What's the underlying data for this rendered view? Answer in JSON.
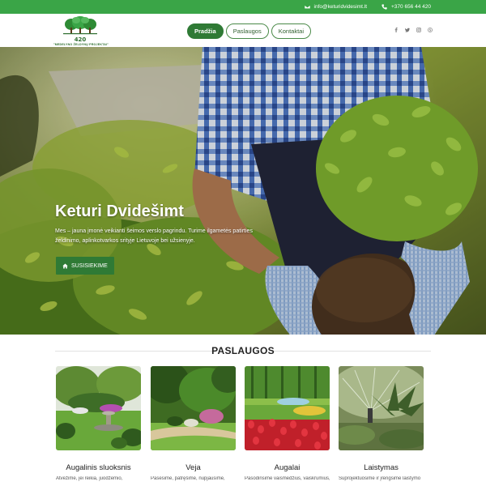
{
  "topbar": {
    "email": "info@keturidvidesimt.lt",
    "phone": "+370 656 44 420",
    "icons": [
      "envelope-icon",
      "phone-icon"
    ],
    "bg_color": "#3aa547"
  },
  "header": {
    "logo_number": "420",
    "logo_caption": "\"MEDELYNO ŽELDYNŲ PROJEKTAI\"",
    "nav": [
      {
        "label": "Pradžia",
        "active": true
      },
      {
        "label": "Paslaugos",
        "active": false
      },
      {
        "label": "Kontaktai",
        "active": false
      }
    ],
    "social_icons": [
      "facebook-icon",
      "twitter-icon",
      "instagram-icon",
      "skype-icon"
    ]
  },
  "hero": {
    "title": "Keturi Dvidešimt",
    "text": "Mes – jauna įmonė veikianti šeimos verslo pagrindu. Turime ilgametės patirties želdinimo, aplinkotvarkos srityje Lietuvoje bei užsienyje.",
    "button_label": "SUSISIEKIME",
    "button_icon": "home-icon",
    "accent_color": "#2f7a35"
  },
  "services": {
    "heading": "PASLAUGOS",
    "cards": [
      {
        "title": "Augalinis sluoksnis",
        "desc": "Atvežime, jei reikia, juodžemio,"
      },
      {
        "title": "Veja",
        "desc": "Pasėsime, patręšime, nupjausime,"
      },
      {
        "title": "Augalai",
        "desc": "Pasodinsime vaismedžius, vaiskrūmius,"
      },
      {
        "title": "Laistymas",
        "desc": "Suprojektuosime ir įrengsime laistymo"
      }
    ]
  }
}
